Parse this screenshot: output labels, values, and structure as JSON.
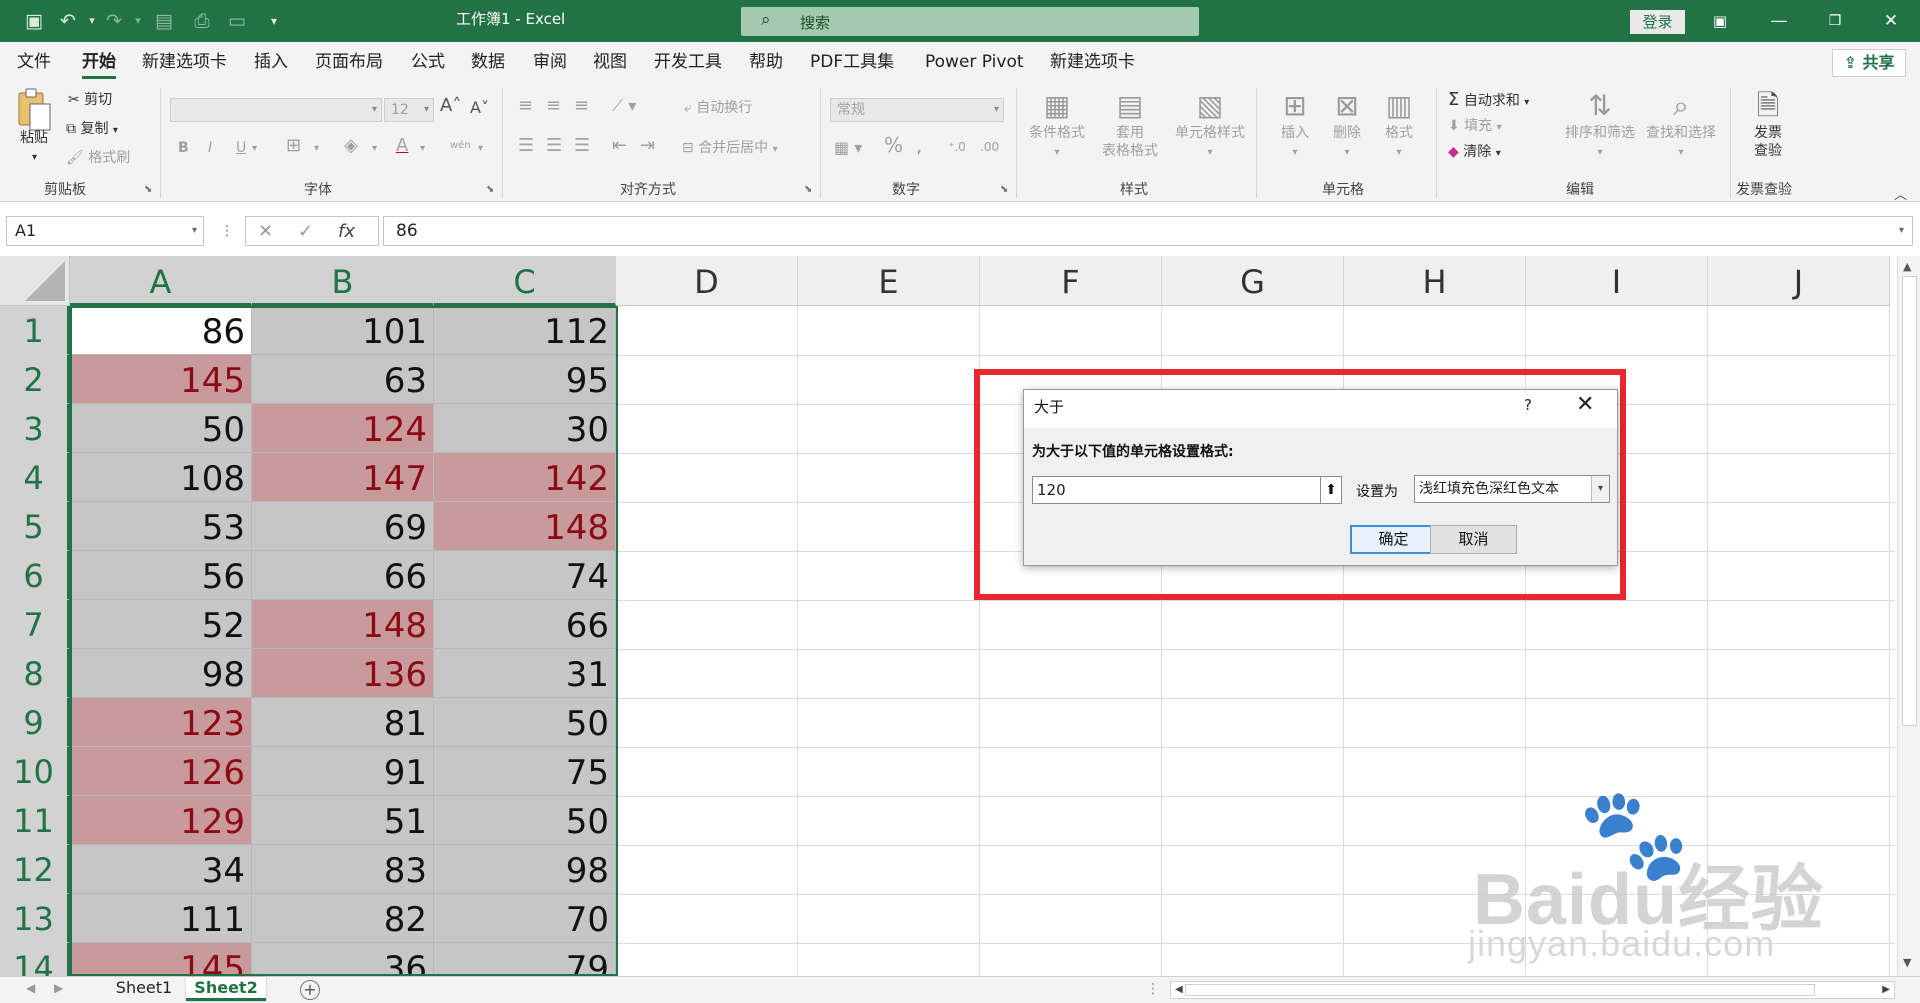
{
  "app": {
    "title": "工作簿1  -  Excel",
    "search_placeholder": "搜索",
    "login_label": "登录",
    "accent_color": "#217346"
  },
  "quick_access": [
    "save-icon",
    "undo-icon",
    "redo-icon",
    "form-icon",
    "print-icon",
    "print-preview-icon",
    "customize-icon"
  ],
  "menu_tabs": [
    "文件",
    "开始",
    "新建选项卡",
    "插入",
    "页面布局",
    "公式",
    "数据",
    "审阅",
    "视图",
    "开发工具",
    "帮助",
    "PDF工具集",
    "Power Pivot",
    "新建选项卡"
  ],
  "share_label": "共享",
  "ribbon": {
    "clipboard": {
      "label": "剪贴板",
      "paste": "粘贴",
      "cut": "剪切",
      "copy": "复制",
      "format_painter": "格式刷"
    },
    "font": {
      "label": "字体",
      "size": "12",
      "bold": "B",
      "italic": "I",
      "underline": "U",
      "phonetic": "wén"
    },
    "alignment": {
      "label": "对齐方式",
      "wrap": "自动换行",
      "merge": "合并后居中"
    },
    "number": {
      "label": "数字",
      "format": "常规",
      "percent": "%"
    },
    "styles": {
      "label": "样式",
      "conditional": "条件格式",
      "table_1": "套用",
      "table_2": "表格格式",
      "cell_styles": "单元格样式"
    },
    "cells": {
      "label": "单元格",
      "insert": "插入",
      "delete": "删除",
      "format": "格式"
    },
    "editing": {
      "label": "编辑",
      "autosum": "自动求和",
      "fill": "填充",
      "clear": "清除",
      "sort": "排序和筛选",
      "find": "查找和选择"
    },
    "invoice": {
      "label": "发票查验",
      "btn_1": "发票",
      "btn_2": "查验"
    }
  },
  "formula_bar": {
    "name_box": "A1",
    "fx": "fx",
    "value": "86"
  },
  "columns": [
    "A",
    "B",
    "C",
    "D",
    "E",
    "F",
    "G",
    "H",
    "I",
    "J"
  ],
  "rows": [
    "1",
    "2",
    "3",
    "4",
    "5",
    "6",
    "7",
    "8",
    "9",
    "10",
    "11",
    "12",
    "13",
    "14"
  ],
  "cells": [
    {
      "a": {
        "v": "86",
        "hl": false
      },
      "b": {
        "v": "101",
        "hl": false
      },
      "c": {
        "v": "112",
        "hl": false
      }
    },
    {
      "a": {
        "v": "145",
        "hl": true
      },
      "b": {
        "v": "63",
        "hl": false
      },
      "c": {
        "v": "95",
        "hl": false
      }
    },
    {
      "a": {
        "v": "50",
        "hl": false
      },
      "b": {
        "v": "124",
        "hl": true
      },
      "c": {
        "v": "30",
        "hl": false
      }
    },
    {
      "a": {
        "v": "108",
        "hl": false
      },
      "b": {
        "v": "147",
        "hl": true
      },
      "c": {
        "v": "142",
        "hl": true
      }
    },
    {
      "a": {
        "v": "53",
        "hl": false
      },
      "b": {
        "v": "69",
        "hl": false
      },
      "c": {
        "v": "148",
        "hl": true
      }
    },
    {
      "a": {
        "v": "56",
        "hl": false
      },
      "b": {
        "v": "66",
        "hl": false
      },
      "c": {
        "v": "74",
        "hl": false
      }
    },
    {
      "a": {
        "v": "52",
        "hl": false
      },
      "b": {
        "v": "148",
        "hl": true
      },
      "c": {
        "v": "66",
        "hl": false
      }
    },
    {
      "a": {
        "v": "98",
        "hl": false
      },
      "b": {
        "v": "136",
        "hl": true
      },
      "c": {
        "v": "31",
        "hl": false
      }
    },
    {
      "a": {
        "v": "123",
        "hl": true
      },
      "b": {
        "v": "81",
        "hl": false
      },
      "c": {
        "v": "50",
        "hl": false
      }
    },
    {
      "a": {
        "v": "126",
        "hl": true
      },
      "b": {
        "v": "91",
        "hl": false
      },
      "c": {
        "v": "75",
        "hl": false
      }
    },
    {
      "a": {
        "v": "129",
        "hl": true
      },
      "b": {
        "v": "51",
        "hl": false
      },
      "c": {
        "v": "50",
        "hl": false
      }
    },
    {
      "a": {
        "v": "34",
        "hl": false
      },
      "b": {
        "v": "83",
        "hl": false
      },
      "c": {
        "v": "98",
        "hl": false
      }
    },
    {
      "a": {
        "v": "111",
        "hl": false
      },
      "b": {
        "v": "82",
        "hl": false
      },
      "c": {
        "v": "70",
        "hl": false
      }
    },
    {
      "a": {
        "v": "145",
        "hl": true
      },
      "b": {
        "v": "36",
        "hl": false
      },
      "c": {
        "v": "79",
        "hl": false
      }
    }
  ],
  "colors": {
    "highlight_fill": "#c89a9c",
    "highlight_text": "#8b0a14",
    "selected_fill": "#c6c6c6",
    "annotation_red": "#e8282e"
  },
  "sheets": [
    "Sheet1",
    "Sheet2"
  ],
  "active_sheet": "Sheet2",
  "dialog": {
    "title": "大于",
    "help": "?",
    "close": "✕",
    "prompt": "为大于以下值的单元格设置格式:",
    "value": "120",
    "set_as_label": "设置为",
    "format_option": "浅红填充色深红色文本",
    "ok_label": "确定",
    "cancel_label": "取消"
  },
  "watermark": {
    "brand": "Baidu经验",
    "url": "jingyan.baidu.com"
  }
}
